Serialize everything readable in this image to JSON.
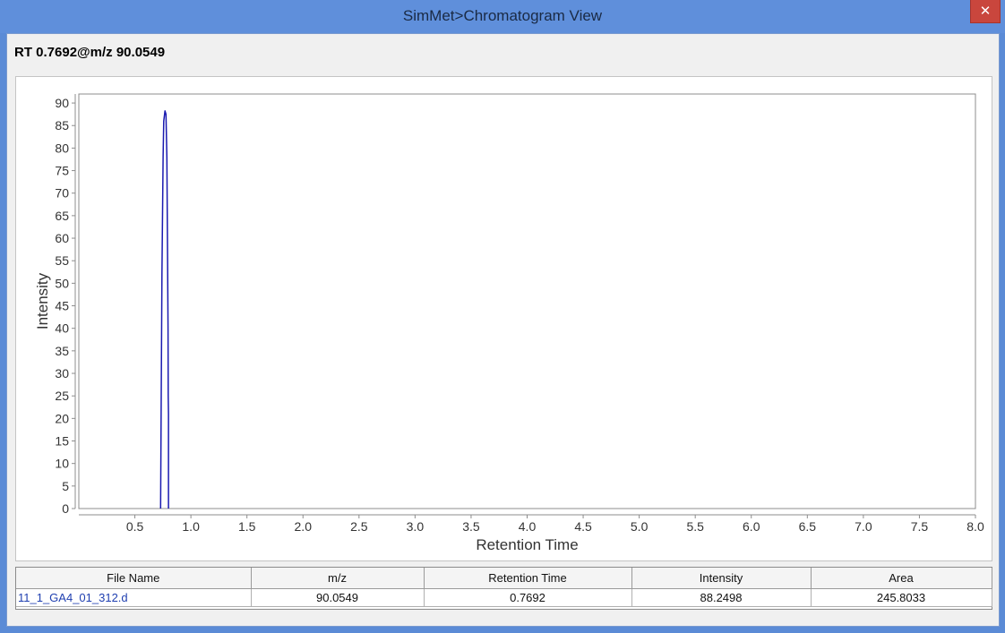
{
  "window": {
    "title": "SimMet>Chromatogram View",
    "close_glyph": "✕"
  },
  "header": {
    "label": "RT 0.7692@m/z 90.0549"
  },
  "chart_data": {
    "type": "line",
    "xlabel": "Retention Time",
    "ylabel": "Intensity",
    "xlim": [
      0.0,
      8.0
    ],
    "ylim": [
      0,
      92
    ],
    "x_ticks": [
      0.5,
      1.0,
      1.5,
      2.0,
      2.5,
      3.0,
      3.5,
      4.0,
      4.5,
      5.0,
      5.5,
      6.0,
      6.5,
      7.0,
      7.5,
      8.0
    ],
    "x_tick_labels": [
      "0.5",
      "1.0",
      "1.5",
      "2.0",
      "2.5",
      "3.0",
      "3.5",
      "4.0",
      "4.5",
      "5.0",
      "5.5",
      "6.0",
      "6.5",
      "7.0",
      "7.5",
      "8.0"
    ],
    "y_ticks": [
      0,
      5,
      10,
      15,
      20,
      25,
      30,
      35,
      40,
      45,
      50,
      55,
      60,
      65,
      70,
      75,
      80,
      85,
      90
    ],
    "grid": false,
    "color": "#1a1ab0",
    "x": [
      0.73,
      0.735,
      0.742,
      0.752,
      0.758,
      0.7692,
      0.778,
      0.786,
      0.792,
      0.796,
      0.798,
      0.8,
      0.8
    ],
    "y": [
      0,
      25,
      52,
      78,
      86,
      88.2498,
      87.5,
      78,
      55,
      40,
      25,
      21,
      0
    ]
  },
  "table": {
    "columns": [
      "File Name",
      "m/z",
      "Retention Time",
      "Intensity",
      "Area"
    ],
    "rows": [
      [
        "11_1_GA4_01_312.d",
        "90.0549",
        "0.7692",
        "88.2498",
        "245.8033"
      ]
    ]
  }
}
